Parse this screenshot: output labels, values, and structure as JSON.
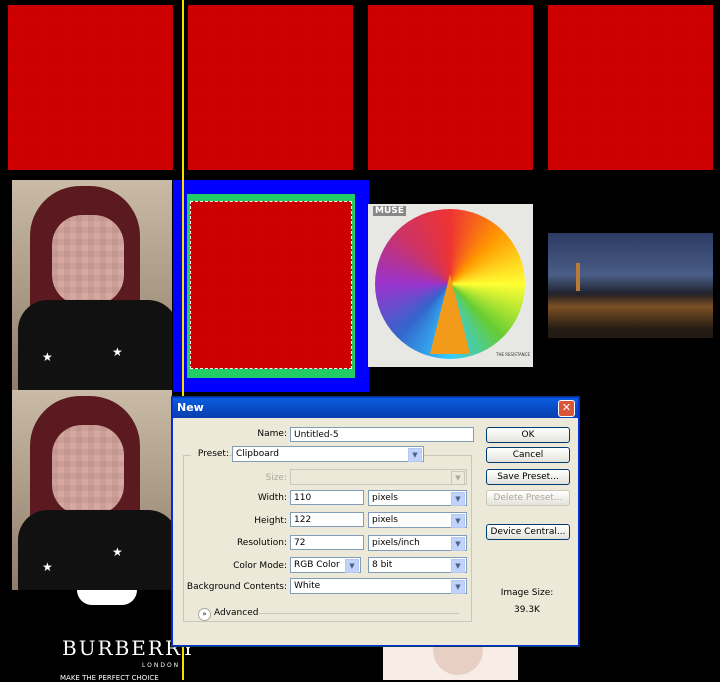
{
  "dialog": {
    "title": "New",
    "close_glyph": "✕",
    "name_label": "Name:",
    "name_value": "Untitled-5",
    "preset_label": "Preset:",
    "preset_value": "Clipboard",
    "size_label": "Size:",
    "size_value": "",
    "width_label": "Width:",
    "width_value": "110",
    "width_unit": "pixels",
    "height_label": "Height:",
    "height_value": "122",
    "height_unit": "pixels",
    "resolution_label": "Resolution:",
    "resolution_value": "72",
    "resolution_unit": "pixels/inch",
    "color_mode_label": "Color Mode:",
    "color_mode_value": "RGB Color",
    "bit_depth_value": "8 bit",
    "background_label": "Background Contents:",
    "background_value": "White",
    "advanced_label": "Advanced",
    "ok_label": "OK",
    "cancel_label": "Cancel",
    "save_preset_label": "Save Preset...",
    "delete_preset_label": "Delete Preset...",
    "device_central_label": "Device Central...",
    "image_size_label": "Image Size:",
    "image_size_value": "39.3K"
  },
  "canvas": {
    "album_art_text": "MUSE",
    "album_small_text": "THE RESISTANCE",
    "ad_brand": "BURBERRY",
    "ad_sub": "LONDON",
    "ad_tagline": "MAKE THE PERFECT CHOICE"
  },
  "colors": {
    "swatch_red": "#d10000",
    "selection_blue": "#0000ff",
    "selection_green": "#22cc66",
    "guide_yellow": "#f5e000"
  }
}
